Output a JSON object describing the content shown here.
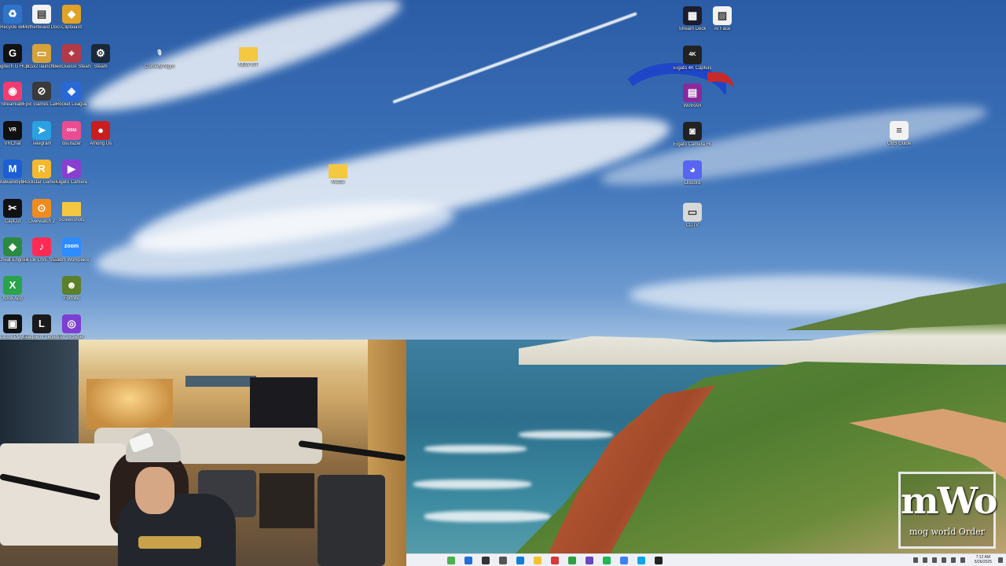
{
  "desktop": {
    "icons": [
      {
        "name": "recycle-bin-icon",
        "label": "Recycle Bin",
        "color": "#2f74c9",
        "glyph": "♻"
      },
      {
        "name": "document-shortcut-icon",
        "label": "Motherboard Documentation",
        "color": "#f2f2f2",
        "glyph": "▤"
      },
      {
        "name": "game-shortcut-1-icon",
        "label": "Clipboard",
        "color": "#e0a328",
        "glyph": "◆"
      },
      {
        "name": "g-hub-icon",
        "label": "Logitech G HUB",
        "color": "#111111",
        "glyph": "G"
      },
      {
        "name": "pc-app-icon",
        "label": "pcsx2 launcher",
        "color": "#d7a23a",
        "glyph": "▭"
      },
      {
        "name": "geoguessr-icon",
        "label": "GeoGuessr Steam",
        "color": "#b23a48",
        "glyph": "⌖"
      },
      {
        "name": "steam-icon",
        "label": "Steam",
        "color": "#1b2838",
        "glyph": "⚙"
      },
      {
        "name": "microphone-shortcut-icon",
        "label": "Comedy Night",
        "color": "transparent",
        "glyph": "🎙"
      },
      {
        "name": "folder-icon",
        "label": "NEW KIT",
        "color": "#f5c842",
        "glyph": ""
      },
      {
        "name": "spotify-like-icon",
        "label": "Streamlabs",
        "color": "#f23c6f",
        "glyph": "◉"
      },
      {
        "name": "controller-app-icon",
        "label": "Epic Games Launcher",
        "color": "#3a3a3a",
        "glyph": "⊘"
      },
      {
        "name": "rocket-league-icon",
        "label": "Rocket League",
        "color": "#2a68d8",
        "glyph": "◈"
      },
      {
        "name": "vr-icon",
        "label": "VRChat",
        "color": "#101010",
        "glyph": "VR"
      },
      {
        "name": "telegram-icon",
        "label": "Telegram",
        "color": "#2aa1e0",
        "glyph": "➤"
      },
      {
        "name": "osu-icon",
        "label": "osu!lazer",
        "color": "#ea4d92",
        "glyph": "osu"
      },
      {
        "name": "among-us-icon",
        "label": "Among Us",
        "color": "#c91e1e",
        "glyph": "●"
      },
      {
        "name": "malwarebytes-icon",
        "label": "Malwarebytes",
        "color": "#1b5fd6",
        "glyph": "M"
      },
      {
        "name": "rockstar-icon",
        "label": "Rockstar Games Launcher",
        "color": "#f5b82e",
        "glyph": "R"
      },
      {
        "name": "video-app-icon",
        "label": "Elgato Camera",
        "color": "#8a3fd1",
        "glyph": "▶"
      },
      {
        "name": "folder-small-icon",
        "label": "Media",
        "color": "#f5c842",
        "glyph": ""
      },
      {
        "name": "capcut-icon",
        "label": "CapCut",
        "color": "#111111",
        "glyph": "✂"
      },
      {
        "name": "overwatch-icon",
        "label": "Overwatch 2",
        "color": "#f08c1e",
        "glyph": "⊙"
      },
      {
        "name": "folder-2-icon",
        "label": "Screenshots",
        "color": "#f5c842",
        "glyph": ""
      },
      {
        "name": "game-cube-icon",
        "label": "Cheat Engine",
        "color": "#2a8a3f",
        "glyph": "◆"
      },
      {
        "name": "tiktok-icon",
        "label": "TikTok LIVE Studio",
        "color": "#fe2c55",
        "glyph": "♪"
      },
      {
        "name": "zoom-icon",
        "label": "Zoom Workplace",
        "color": "#2d8cff",
        "glyph": "zoom"
      },
      {
        "name": "xbox-icon",
        "label": "Xbox App",
        "color": "#2aa34a",
        "glyph": "X"
      },
      {
        "name": "goblin-icon",
        "label": "Fortnite",
        "color": "#5c7f2a",
        "glyph": "☻"
      },
      {
        "name": "roblox-icon",
        "label": "Roblox Player",
        "color": "#111111",
        "glyph": "▣"
      },
      {
        "name": "league-icon",
        "label": "League of Legends",
        "color": "#1a1a1a",
        "glyph": "L"
      },
      {
        "name": "tor-icon",
        "label": "Tor Browser",
        "color": "#7c3fd1",
        "glyph": "◎"
      },
      {
        "name": "stream-deck-icon",
        "label": "Stream Deck",
        "color": "#1c1c2c",
        "glyph": "▦"
      },
      {
        "name": "ai-face-icon",
        "label": "AI Face",
        "color": "#f2f2f2",
        "glyph": "▨"
      },
      {
        "name": "elgato-4k-icon",
        "label": "Elgato 4K Capture",
        "color": "#222222",
        "glyph": "4K"
      },
      {
        "name": "winrar-icon",
        "label": "WinRAR",
        "color": "#8a2a9a",
        "glyph": "▤"
      },
      {
        "name": "camera-hub-icon",
        "label": "Elgato Camera Hub",
        "color": "#222222",
        "glyph": "◙"
      },
      {
        "name": "discord-icon",
        "label": "Discord",
        "color": "#5865f2",
        "glyph": "◕"
      },
      {
        "name": "drive-icon",
        "label": "CDTV",
        "color": "#d8d8d8",
        "glyph": "▭"
      },
      {
        "name": "text-file-icon",
        "label": "OBS Guide",
        "color": "#f2f2f2",
        "glyph": "≡"
      }
    ]
  },
  "taskbar": {
    "clock_time": "7:12 AM",
    "clock_date": "5/26/2025",
    "apps": [
      {
        "name": "taskbar-widgets-icon",
        "color": "#4caf50"
      },
      {
        "name": "taskbar-start-icon",
        "color": "#1e6fd9"
      },
      {
        "name": "taskbar-search-icon",
        "color": "#333333"
      },
      {
        "name": "taskbar-task-view-icon",
        "color": "#555555"
      },
      {
        "name": "taskbar-edge-icon",
        "color": "#0f7dd6"
      },
      {
        "name": "taskbar-explorer-icon",
        "color": "#f2c232"
      },
      {
        "name": "taskbar-app-red-icon",
        "color": "#d93838"
      },
      {
        "name": "taskbar-chrome-icon",
        "color": "#2ea043"
      },
      {
        "name": "taskbar-purple-icon",
        "color": "#6b46c1"
      },
      {
        "name": "taskbar-spotify-icon",
        "color": "#1db954"
      },
      {
        "name": "taskbar-obs-icon",
        "color": "#3b82f6"
      },
      {
        "name": "taskbar-store-icon",
        "color": "#0ea5e9"
      },
      {
        "name": "taskbar-terminal-icon",
        "color": "#222222"
      }
    ]
  },
  "watermark": {
    "big": "mWo",
    "small": "mog world Order"
  }
}
